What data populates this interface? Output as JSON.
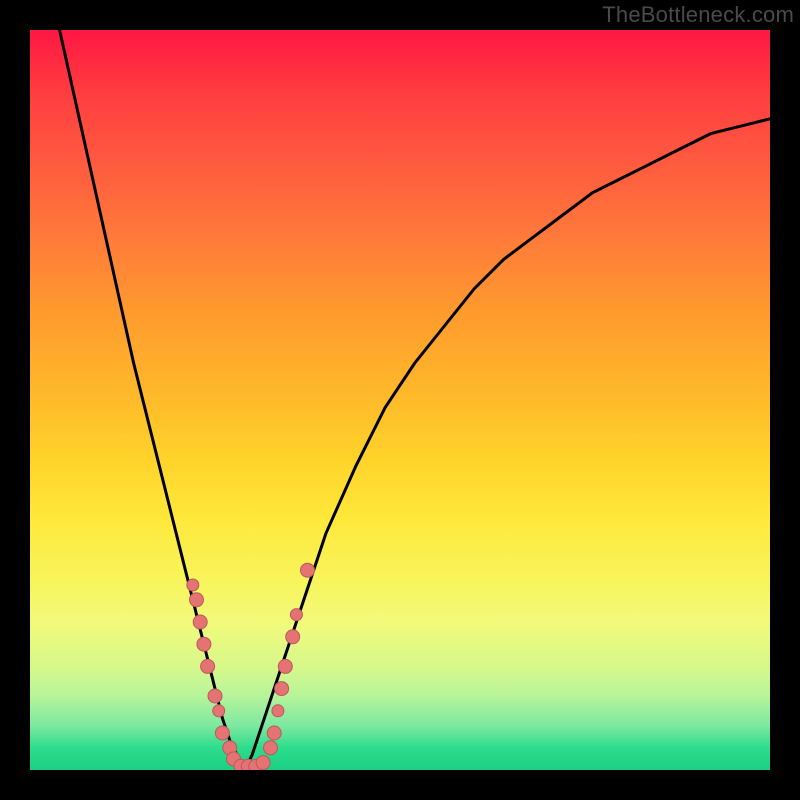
{
  "watermark": "TheBottleneck.com",
  "colors": {
    "frame": "#000000",
    "curve": "#000000",
    "dot_fill": "#e57373",
    "dot_stroke": "#b85a5a",
    "gradient_top": "#ff1744",
    "gradient_bottom": "#1ad084"
  },
  "chart_data": {
    "type": "line",
    "title": "",
    "xlabel": "",
    "ylabel": "",
    "xlim": [
      0,
      100
    ],
    "ylim": [
      0,
      100
    ],
    "grid": false,
    "legend": "none",
    "annotations": [
      "TheBottleneck.com"
    ],
    "series": [
      {
        "name": "curve",
        "x": [
          4,
          6,
          8,
          10,
          12,
          14,
          16,
          18,
          20,
          22,
          24,
          25,
          26,
          27,
          28,
          29,
          30,
          32,
          34,
          36,
          38,
          40,
          44,
          48,
          52,
          56,
          60,
          64,
          68,
          72,
          76,
          80,
          84,
          88,
          92,
          96,
          100
        ],
        "y": [
          100,
          91,
          82,
          73,
          64,
          55,
          47,
          39,
          31,
          23,
          15,
          11,
          7,
          4,
          2,
          0,
          2,
          8,
          14,
          20,
          26,
          32,
          41,
          49,
          55,
          60,
          65,
          69,
          72,
          75,
          78,
          80,
          82,
          84,
          86,
          87,
          88
        ]
      }
    ],
    "scatter": [
      {
        "name": "dots",
        "points": [
          {
            "x": 22,
            "y": 25,
            "r": 6
          },
          {
            "x": 22.5,
            "y": 23,
            "r": 7
          },
          {
            "x": 23,
            "y": 20,
            "r": 7
          },
          {
            "x": 23.5,
            "y": 17,
            "r": 7
          },
          {
            "x": 24,
            "y": 14,
            "r": 7
          },
          {
            "x": 25,
            "y": 10,
            "r": 7
          },
          {
            "x": 25.5,
            "y": 8,
            "r": 6
          },
          {
            "x": 26,
            "y": 5,
            "r": 7
          },
          {
            "x": 27,
            "y": 3,
            "r": 7
          },
          {
            "x": 27.5,
            "y": 1.5,
            "r": 7
          },
          {
            "x": 28.5,
            "y": 0.5,
            "r": 7
          },
          {
            "x": 29.5,
            "y": 0.5,
            "r": 7
          },
          {
            "x": 30.5,
            "y": 0.5,
            "r": 7
          },
          {
            "x": 31.5,
            "y": 1,
            "r": 7
          },
          {
            "x": 32.5,
            "y": 3,
            "r": 7
          },
          {
            "x": 33,
            "y": 5,
            "r": 7
          },
          {
            "x": 33.5,
            "y": 8,
            "r": 6
          },
          {
            "x": 34,
            "y": 11,
            "r": 7
          },
          {
            "x": 34.5,
            "y": 14,
            "r": 7
          },
          {
            "x": 35.5,
            "y": 18,
            "r": 7
          },
          {
            "x": 36,
            "y": 21,
            "r": 6
          },
          {
            "x": 37.5,
            "y": 27,
            "r": 7
          }
        ]
      }
    ]
  }
}
